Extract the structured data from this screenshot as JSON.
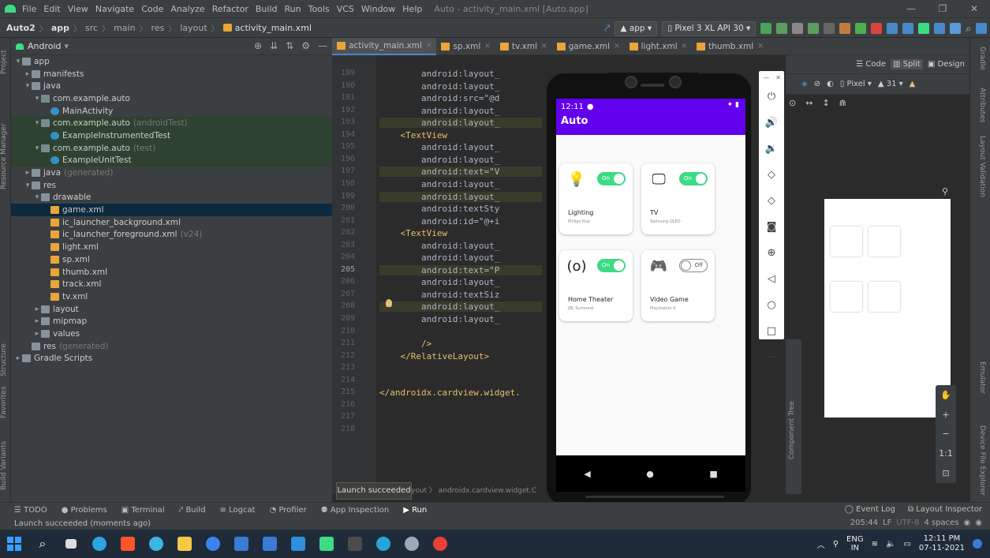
{
  "menubar": {
    "items": [
      "File",
      "Edit",
      "View",
      "Navigate",
      "Code",
      "Analyze",
      "Refactor",
      "Build",
      "Run",
      "Tools",
      "VCS",
      "Window",
      "Help"
    ],
    "title": "Auto - activity_main.xml [Auto.app]"
  },
  "navbar": {
    "crumbs": [
      "Auto2",
      "app",
      "src",
      "main",
      "res",
      "layout",
      "activity_main.xml"
    ],
    "run_config": "app",
    "device": "Pixel 3 XL API 30"
  },
  "project": {
    "view": "Android",
    "tree": [
      {
        "label": "app",
        "suffix": "",
        "level": 0,
        "icon": "folder",
        "arrow": "▾"
      },
      {
        "label": "manifests",
        "suffix": "",
        "level": 1,
        "icon": "folder",
        "arrow": "▸"
      },
      {
        "label": "java",
        "suffix": "",
        "level": 1,
        "icon": "folder",
        "arrow": "▾"
      },
      {
        "label": "com.example.auto",
        "suffix": "",
        "level": 2,
        "icon": "package",
        "arrow": "▾"
      },
      {
        "label": "MainActivity",
        "suffix": "",
        "level": 3,
        "icon": "class",
        "arrow": ""
      },
      {
        "label": "com.example.auto",
        "suffix": "(androidTest)",
        "level": 2,
        "icon": "package",
        "arrow": "▾",
        "hl": true
      },
      {
        "label": "ExampleInstrumentedTest",
        "suffix": "",
        "level": 3,
        "icon": "class",
        "arrow": "",
        "hl": true
      },
      {
        "label": "com.example.auto",
        "suffix": "(test)",
        "level": 2,
        "icon": "package",
        "arrow": "▾",
        "hl": true
      },
      {
        "label": "ExampleUnitTest",
        "suffix": "",
        "level": 3,
        "icon": "class",
        "arrow": "",
        "hl": true
      },
      {
        "label": "java",
        "suffix": "(generated)",
        "level": 1,
        "icon": "folder",
        "arrow": "▸"
      },
      {
        "label": "res",
        "suffix": "",
        "level": 1,
        "icon": "folder",
        "arrow": "▾"
      },
      {
        "label": "drawable",
        "suffix": "",
        "level": 2,
        "icon": "folder",
        "arrow": "▾"
      },
      {
        "label": "game.xml",
        "suffix": "",
        "level": 3,
        "icon": "xml",
        "arrow": "",
        "sel": true
      },
      {
        "label": "ic_launcher_background.xml",
        "suffix": "",
        "level": 3,
        "icon": "xml",
        "arrow": ""
      },
      {
        "label": "ic_launcher_foreground.xml",
        "suffix": "(v24)",
        "level": 3,
        "icon": "xml",
        "arrow": ""
      },
      {
        "label": "light.xml",
        "suffix": "",
        "level": 3,
        "icon": "xml",
        "arrow": ""
      },
      {
        "label": "sp.xml",
        "suffix": "",
        "level": 3,
        "icon": "xml",
        "arrow": ""
      },
      {
        "label": "thumb.xml",
        "suffix": "",
        "level": 3,
        "icon": "xml",
        "arrow": ""
      },
      {
        "label": "track.xml",
        "suffix": "",
        "level": 3,
        "icon": "xml",
        "arrow": ""
      },
      {
        "label": "tv.xml",
        "suffix": "",
        "level": 3,
        "icon": "xml",
        "arrow": ""
      },
      {
        "label": "layout",
        "suffix": "",
        "level": 2,
        "icon": "folder",
        "arrow": "▸"
      },
      {
        "label": "mipmap",
        "suffix": "",
        "level": 2,
        "icon": "folder",
        "arrow": "▸"
      },
      {
        "label": "values",
        "suffix": "",
        "level": 2,
        "icon": "folder",
        "arrow": "▸"
      },
      {
        "label": "res",
        "suffix": "(generated)",
        "level": 1,
        "icon": "folder",
        "arrow": ""
      },
      {
        "label": "Gradle Scripts",
        "suffix": "",
        "level": 0,
        "icon": "folder",
        "arrow": "▸"
      }
    ]
  },
  "tabs": [
    "activity_main.xml",
    "sp.xml",
    "tv.xml",
    "game.xml",
    "light.xml",
    "thumb.xml"
  ],
  "editor": {
    "lines": [
      {
        "n": "189",
        "t": "        android:layout_"
      },
      {
        "n": "190",
        "t": "        android:layout_"
      },
      {
        "n": "191",
        "t": "        android:src=\"@d"
      },
      {
        "n": "192",
        "t": "        android:layout_"
      },
      {
        "n": "193",
        "t": "        android:layout_"
      },
      {
        "n": "194",
        "t": "    <TextView"
      },
      {
        "n": "195",
        "t": "        android:layout_"
      },
      {
        "n": "196",
        "t": "        android:layout_"
      },
      {
        "n": "197",
        "t": "        android:text=\"V"
      },
      {
        "n": "198",
        "t": "        android:layout_"
      },
      {
        "n": "199",
        "t": "        android:layout_"
      },
      {
        "n": "200",
        "t": "        android:textSty"
      },
      {
        "n": "201",
        "t": "        android:id=\"@+i"
      },
      {
        "n": "202",
        "t": "    <TextView"
      },
      {
        "n": "203",
        "t": "        android:layout_"
      },
      {
        "n": "204",
        "t": "        android:layout_"
      },
      {
        "n": "205",
        "t": "        android:text=\"P"
      },
      {
        "n": "206",
        "t": "        android:layout_"
      },
      {
        "n": "207",
        "t": "        android:textSiz"
      },
      {
        "n": "208",
        "t": "        android:layout_"
      },
      {
        "n": "209",
        "t": "        android:layout_"
      },
      {
        "n": "210",
        "t": ""
      },
      {
        "n": "211",
        "t": "        />"
      },
      {
        "n": "212",
        "t": "    </RelativeLayout>"
      },
      {
        "n": "213",
        "t": ""
      },
      {
        "n": "214",
        "t": ""
      },
      {
        "n": "215",
        "t": "</androidx.cardview.widget."
      },
      {
        "n": "216",
        "t": ""
      },
      {
        "n": "217",
        "t": ""
      },
      {
        "n": "218",
        "t": ""
      }
    ],
    "current_line": "205"
  },
  "phone": {
    "time": "12:11",
    "app_title": "Auto",
    "cards": [
      {
        "name": "Lighting",
        "sub": "Philips Hue",
        "toggle": "On",
        "icon": "bulb-icon",
        "glyph": "💡"
      },
      {
        "name": "TV",
        "sub": "Samsung QLED",
        "toggle": "On",
        "icon": "monitor-icon",
        "glyph": "🖵"
      },
      {
        "name": "Home Theater",
        "sub": "JBL Surround",
        "toggle": "On",
        "icon": "speaker-icon",
        "glyph": "(o)"
      },
      {
        "name": "Video Game",
        "sub": "Playstation 4",
        "toggle": "Off",
        "icon": "gamepad-icon",
        "glyph": "🎮"
      }
    ]
  },
  "design": {
    "code": "Code",
    "split": "Split",
    "design": "Design",
    "device": "Pixel",
    "api": "31"
  },
  "bottom": {
    "tools": [
      "TODO",
      "Problems",
      "Terminal",
      "Build",
      "Logcat",
      "Profiler",
      "App Inspection",
      "Run"
    ],
    "right": [
      "Event Log",
      "Layout Inspector"
    ],
    "status": "Launch succeeded (moments ago)",
    "pos": "205:44",
    "lf": "LF",
    "enc": "UTF-8",
    "indent": "4 spaces"
  },
  "toast": "Launch succeeded",
  "crumbbar": "yout 〉 androidx.cardview.widget.C",
  "taskbar": {
    "lang1": "ENG",
    "lang2": "IN",
    "time": "12:11 PM",
    "date": "07-11-2021"
  },
  "strips": {
    "left": [
      "Project",
      "Resource Manager",
      "Structure",
      "Favorites",
      "Build Variants"
    ],
    "right": [
      "Gradle",
      "Attributes",
      "Layout Validation",
      "Emulator",
      "Device File Explorer"
    ],
    "comptree": "Component Tree"
  },
  "colors": {
    "accent": "#6200ee",
    "toggle_on": "#3ddc84"
  }
}
